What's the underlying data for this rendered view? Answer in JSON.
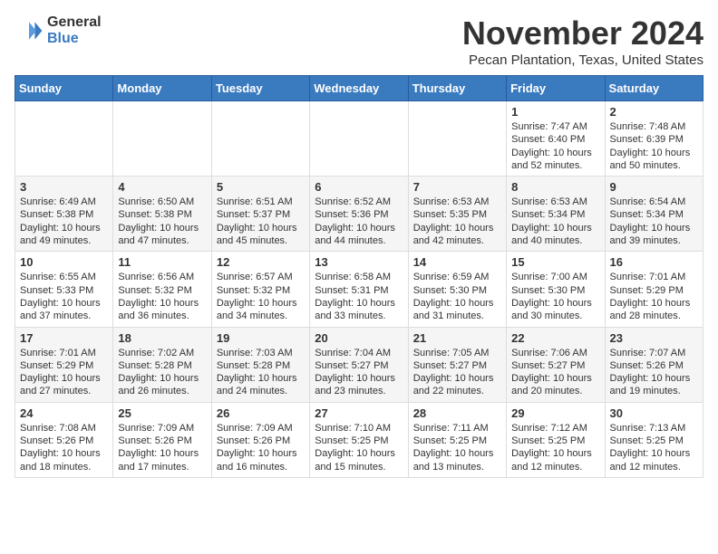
{
  "logo": {
    "general": "General",
    "blue": "Blue"
  },
  "title": "November 2024",
  "location": "Pecan Plantation, Texas, United States",
  "days_of_week": [
    "Sunday",
    "Monday",
    "Tuesday",
    "Wednesday",
    "Thursday",
    "Friday",
    "Saturday"
  ],
  "weeks": [
    [
      {
        "day": "",
        "data": ""
      },
      {
        "day": "",
        "data": ""
      },
      {
        "day": "",
        "data": ""
      },
      {
        "day": "",
        "data": ""
      },
      {
        "day": "",
        "data": ""
      },
      {
        "day": "1",
        "data": "Sunrise: 7:47 AM\nSunset: 6:40 PM\nDaylight: 10 hours and 52 minutes."
      },
      {
        "day": "2",
        "data": "Sunrise: 7:48 AM\nSunset: 6:39 PM\nDaylight: 10 hours and 50 minutes."
      }
    ],
    [
      {
        "day": "3",
        "data": "Sunrise: 6:49 AM\nSunset: 5:38 PM\nDaylight: 10 hours and 49 minutes."
      },
      {
        "day": "4",
        "data": "Sunrise: 6:50 AM\nSunset: 5:38 PM\nDaylight: 10 hours and 47 minutes."
      },
      {
        "day": "5",
        "data": "Sunrise: 6:51 AM\nSunset: 5:37 PM\nDaylight: 10 hours and 45 minutes."
      },
      {
        "day": "6",
        "data": "Sunrise: 6:52 AM\nSunset: 5:36 PM\nDaylight: 10 hours and 44 minutes."
      },
      {
        "day": "7",
        "data": "Sunrise: 6:53 AM\nSunset: 5:35 PM\nDaylight: 10 hours and 42 minutes."
      },
      {
        "day": "8",
        "data": "Sunrise: 6:53 AM\nSunset: 5:34 PM\nDaylight: 10 hours and 40 minutes."
      },
      {
        "day": "9",
        "data": "Sunrise: 6:54 AM\nSunset: 5:34 PM\nDaylight: 10 hours and 39 minutes."
      }
    ],
    [
      {
        "day": "10",
        "data": "Sunrise: 6:55 AM\nSunset: 5:33 PM\nDaylight: 10 hours and 37 minutes."
      },
      {
        "day": "11",
        "data": "Sunrise: 6:56 AM\nSunset: 5:32 PM\nDaylight: 10 hours and 36 minutes."
      },
      {
        "day": "12",
        "data": "Sunrise: 6:57 AM\nSunset: 5:32 PM\nDaylight: 10 hours and 34 minutes."
      },
      {
        "day": "13",
        "data": "Sunrise: 6:58 AM\nSunset: 5:31 PM\nDaylight: 10 hours and 33 minutes."
      },
      {
        "day": "14",
        "data": "Sunrise: 6:59 AM\nSunset: 5:30 PM\nDaylight: 10 hours and 31 minutes."
      },
      {
        "day": "15",
        "data": "Sunrise: 7:00 AM\nSunset: 5:30 PM\nDaylight: 10 hours and 30 minutes."
      },
      {
        "day": "16",
        "data": "Sunrise: 7:01 AM\nSunset: 5:29 PM\nDaylight: 10 hours and 28 minutes."
      }
    ],
    [
      {
        "day": "17",
        "data": "Sunrise: 7:01 AM\nSunset: 5:29 PM\nDaylight: 10 hours and 27 minutes."
      },
      {
        "day": "18",
        "data": "Sunrise: 7:02 AM\nSunset: 5:28 PM\nDaylight: 10 hours and 26 minutes."
      },
      {
        "day": "19",
        "data": "Sunrise: 7:03 AM\nSunset: 5:28 PM\nDaylight: 10 hours and 24 minutes."
      },
      {
        "day": "20",
        "data": "Sunrise: 7:04 AM\nSunset: 5:27 PM\nDaylight: 10 hours and 23 minutes."
      },
      {
        "day": "21",
        "data": "Sunrise: 7:05 AM\nSunset: 5:27 PM\nDaylight: 10 hours and 22 minutes."
      },
      {
        "day": "22",
        "data": "Sunrise: 7:06 AM\nSunset: 5:27 PM\nDaylight: 10 hours and 20 minutes."
      },
      {
        "day": "23",
        "data": "Sunrise: 7:07 AM\nSunset: 5:26 PM\nDaylight: 10 hours and 19 minutes."
      }
    ],
    [
      {
        "day": "24",
        "data": "Sunrise: 7:08 AM\nSunset: 5:26 PM\nDaylight: 10 hours and 18 minutes."
      },
      {
        "day": "25",
        "data": "Sunrise: 7:09 AM\nSunset: 5:26 PM\nDaylight: 10 hours and 17 minutes."
      },
      {
        "day": "26",
        "data": "Sunrise: 7:09 AM\nSunset: 5:26 PM\nDaylight: 10 hours and 16 minutes."
      },
      {
        "day": "27",
        "data": "Sunrise: 7:10 AM\nSunset: 5:25 PM\nDaylight: 10 hours and 15 minutes."
      },
      {
        "day": "28",
        "data": "Sunrise: 7:11 AM\nSunset: 5:25 PM\nDaylight: 10 hours and 13 minutes."
      },
      {
        "day": "29",
        "data": "Sunrise: 7:12 AM\nSunset: 5:25 PM\nDaylight: 10 hours and 12 minutes."
      },
      {
        "day": "30",
        "data": "Sunrise: 7:13 AM\nSunset: 5:25 PM\nDaylight: 10 hours and 12 minutes."
      }
    ]
  ]
}
